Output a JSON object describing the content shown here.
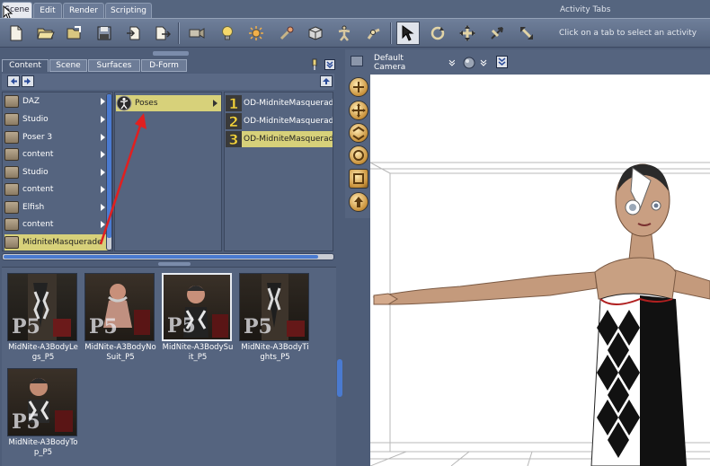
{
  "activity_tabs": {
    "tabs": [
      "Scene",
      "Edit",
      "Render",
      "Scripting"
    ],
    "active": "Scene",
    "label": "Activity Tabs",
    "hint": "Click on a tab to select an activity"
  },
  "toolbar": {
    "buttons": [
      "new-file",
      "open-file",
      "merge",
      "save",
      "import",
      "export",
      "camera",
      "light",
      "spotlight",
      "pointer-tool",
      "primitive",
      "figure",
      "joint",
      "select",
      "rotate",
      "translate",
      "universal",
      "scale"
    ]
  },
  "content_pane": {
    "tabs": [
      "Content",
      "Scene",
      "Surfaces",
      "D-Form"
    ],
    "active_tab": "Content",
    "folders": [
      "DAZ",
      "Studio",
      "Poser 3",
      "content",
      "Studio",
      "content",
      "Elfish",
      "content",
      "MidniteMasquerade"
    ],
    "selected_folder": "MidniteMasquerade",
    "subfolder": "Poses",
    "poses": [
      {
        "num": "1",
        "label": "OD-MidniteMasquerade-c"
      },
      {
        "num": "2",
        "label": "OD-MidniteMasqueradeP"
      },
      {
        "num": "3",
        "label": "OD-MidniteMasqueradeP"
      }
    ],
    "thumbnails": [
      {
        "label": "MidNite-A3BodyLegs_P5"
      },
      {
        "label": "MidNite-A3BodyNoSuit_P5"
      },
      {
        "label": "MidNite-A3BodySuit_P5"
      },
      {
        "label": "MidNite-A3BodyTights_P5"
      },
      {
        "label": "MidNite-A3BodyTop_P5"
      }
    ],
    "thumb_badge": "P5"
  },
  "viewport": {
    "camera": "Default Camera"
  },
  "colors": {
    "selected_row": "#d7d17a",
    "panel": "#4e5d78",
    "scroll_thumb": "#4a7ad0",
    "annotation_arrow": "#e02020"
  }
}
